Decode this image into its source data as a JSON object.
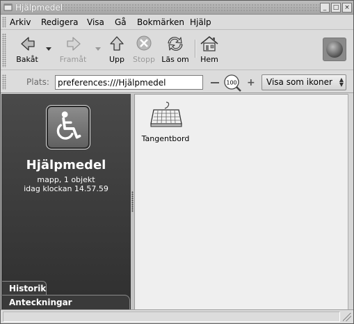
{
  "window": {
    "title": "Hjälpmedel",
    "controls": {
      "minimize": "_",
      "maximize": "□",
      "close": "×"
    }
  },
  "menubar": {
    "items": [
      "Arkiv",
      "Redigera",
      "Visa",
      "Gå",
      "Bokmärken",
      "Hjälp"
    ]
  },
  "toolbar": {
    "back_label": "Bakåt",
    "forward_label": "Framåt",
    "up_label": "Upp",
    "stop_label": "Stopp",
    "reload_label": "Läs om",
    "home_label": "Hem",
    "icons": [
      "back-arrow-icon",
      "forward-arrow-icon",
      "up-arrow-icon",
      "stop-icon",
      "reload-icon",
      "home-icon",
      "throbber-icon"
    ],
    "disabled": [
      "forward",
      "stop"
    ]
  },
  "location": {
    "label": "Plats:",
    "value": "preferences:///Hjälpmedel",
    "zoom_level": "100",
    "view_mode": "Visa som ikoner"
  },
  "sidepane": {
    "icon": "accessibility-wheelchair-icon",
    "title": "Hjälpmedel",
    "info_line1": "mapp, 1 objekt",
    "info_line2": "idag klockan 14.57.59",
    "tabs": [
      "Historik",
      "Anteckningar"
    ]
  },
  "content": {
    "items": [
      {
        "label": "Tangentbord",
        "icon": "keyboard-icon"
      }
    ]
  },
  "colors": {
    "sidepane_bg": "#3c3c3c",
    "content_bg": "#efefef",
    "chrome_bg": "#dcdcdc"
  }
}
